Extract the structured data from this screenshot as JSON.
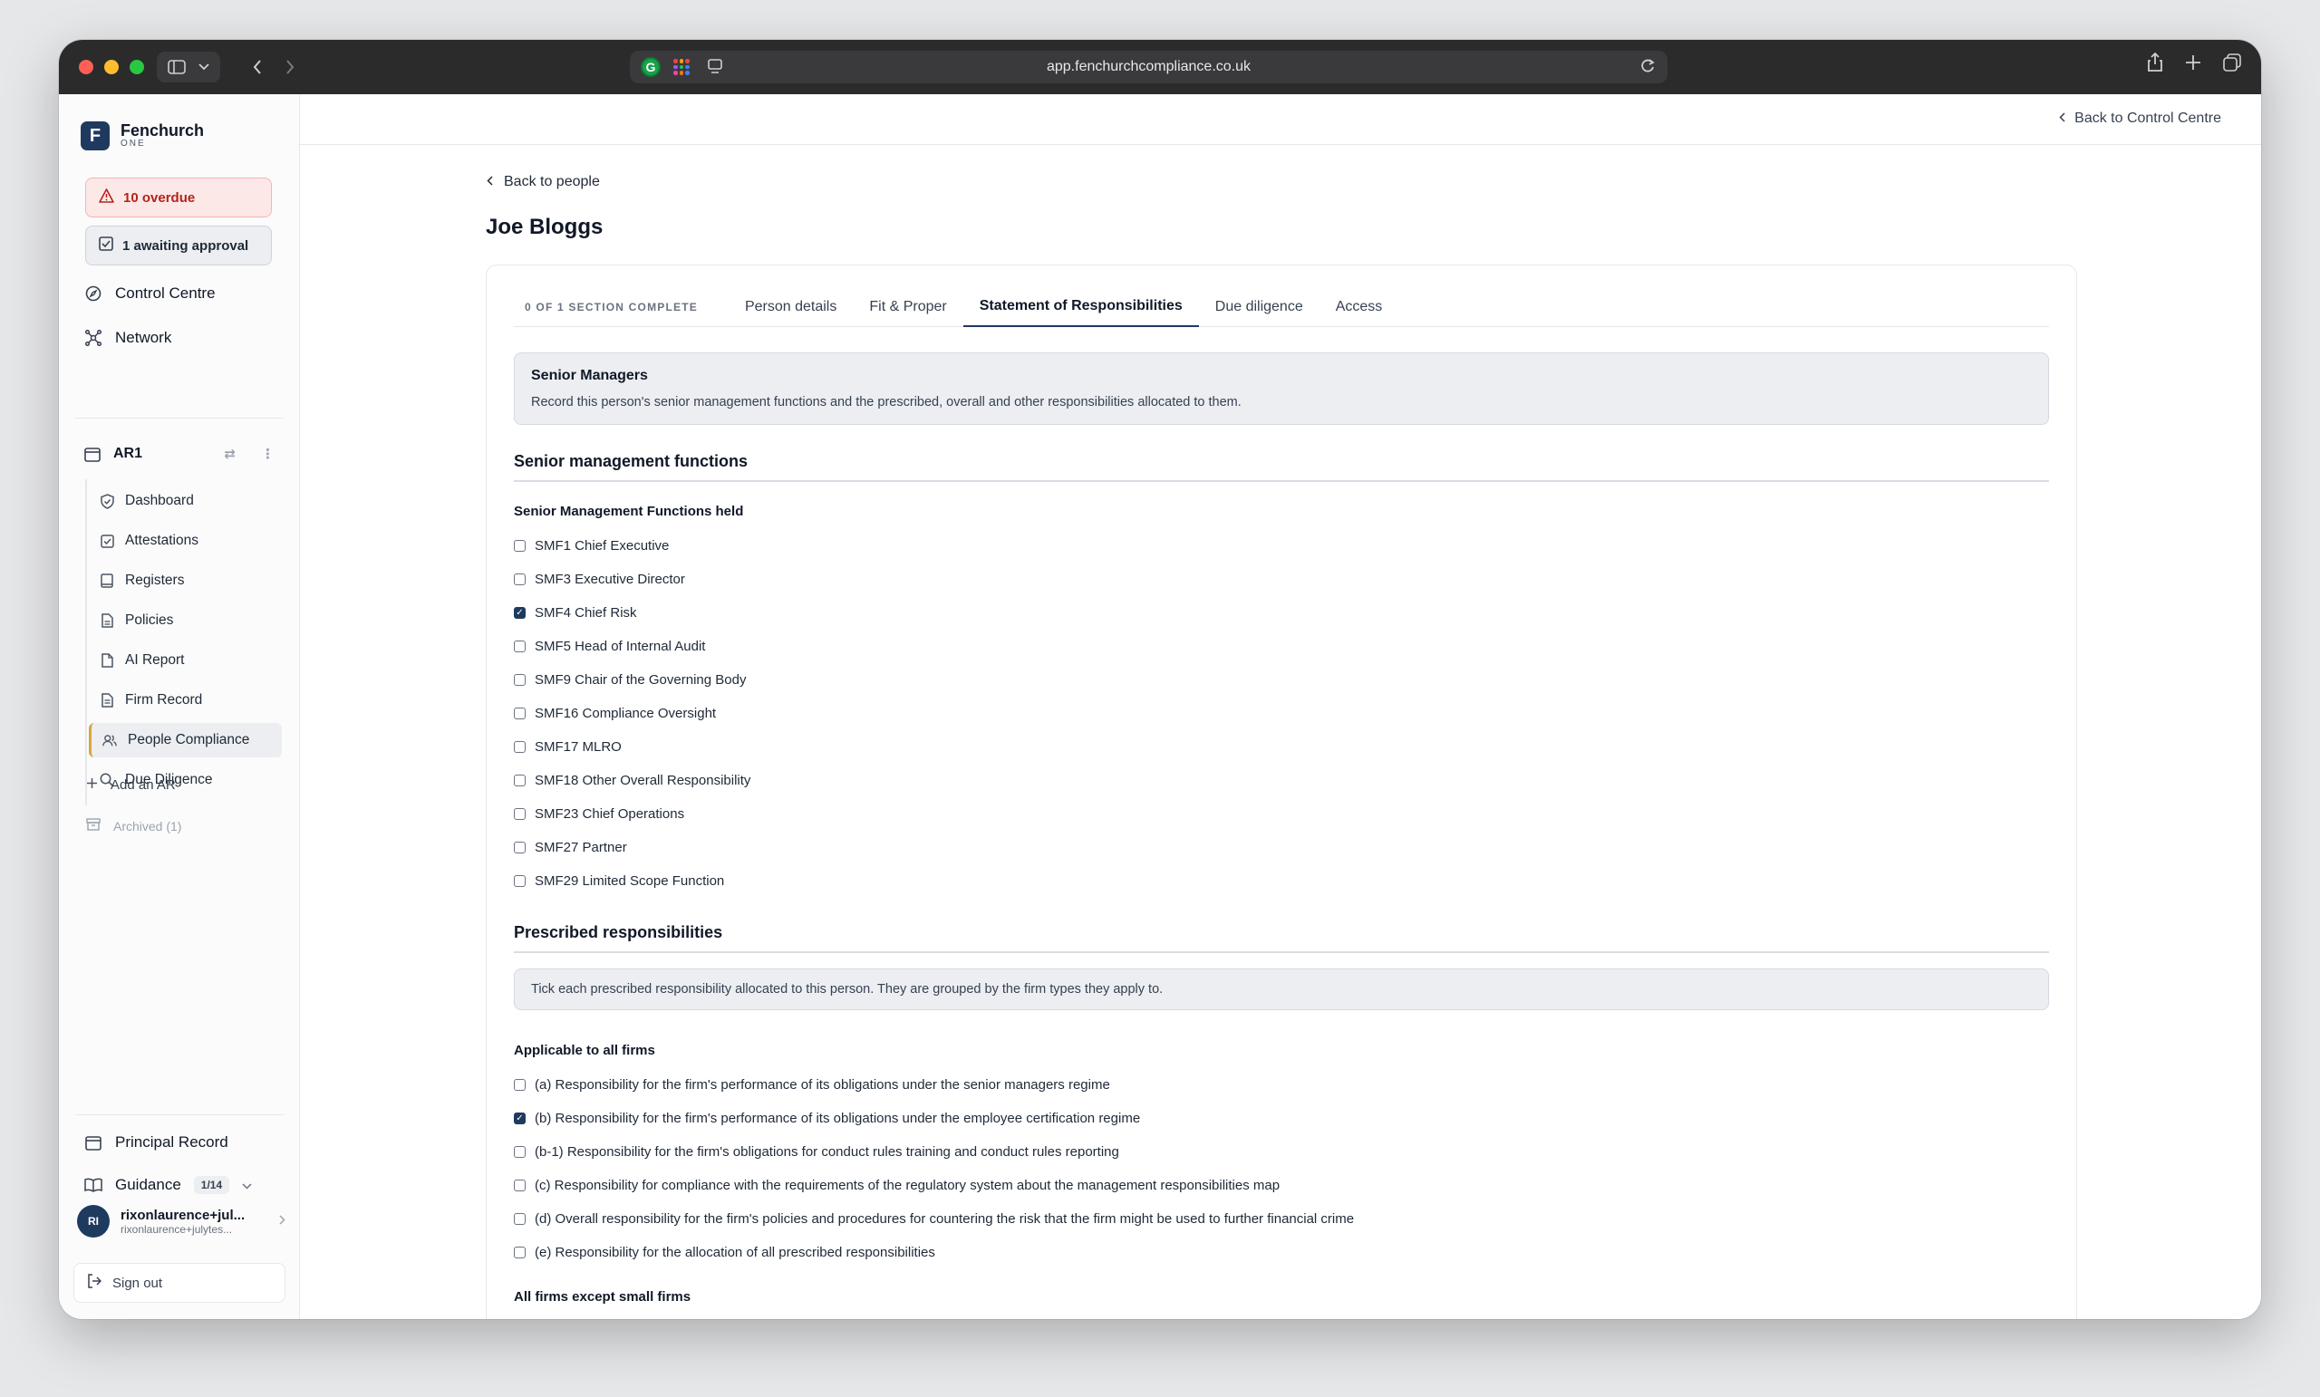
{
  "browser": {
    "url": "app.fenchurchcompliance.co.uk",
    "extension_letter": "G"
  },
  "brand": {
    "name": "Fenchurch",
    "sub": "ONE",
    "logo_letter": "F"
  },
  "alerts": {
    "overdue": "10 overdue",
    "awaiting": "1 awaiting approval"
  },
  "nav": {
    "control_centre": "Control Centre",
    "network": "Network"
  },
  "ar": {
    "name": "AR1",
    "items": [
      {
        "label": "Dashboard",
        "icon": "shield-icon"
      },
      {
        "label": "Attestations",
        "icon": "check-square-icon"
      },
      {
        "label": "Registers",
        "icon": "book-icon"
      },
      {
        "label": "Policies",
        "icon": "document-icon"
      },
      {
        "label": "AI Report",
        "icon": "file-icon"
      },
      {
        "label": "Firm Record",
        "icon": "file-text-icon"
      },
      {
        "label": "People Compliance",
        "icon": "users-icon"
      },
      {
        "label": "Due Diligence",
        "icon": "search-icon"
      }
    ],
    "add": "Add an AR",
    "archived": "Archived (1)"
  },
  "footer_nav": {
    "principal_record": "Principal Record",
    "guidance": "Guidance",
    "guidance_badge": "1/14"
  },
  "user": {
    "initials": "RI",
    "name": "rixonlaurence+jul...",
    "email": "rixonlaurence+julytes..."
  },
  "signout": "Sign out",
  "header": {
    "back_to_cc": "Back to Control Centre"
  },
  "page": {
    "back_to_people": "Back to people",
    "title": "Joe Bloggs"
  },
  "tabs": {
    "progress": "0 OF 1 SECTION COMPLETE",
    "items": [
      "Person details",
      "Fit & Proper",
      "Statement of Responsibilities",
      "Due diligence",
      "Access"
    ],
    "active_index": 2
  },
  "senior_managers": {
    "title": "Senior Managers",
    "text": "Record this person's senior management functions and the prescribed, overall and other responsibilities allocated to them."
  },
  "smf_section": {
    "title": "Senior management functions",
    "group_label": "Senior Management Functions held",
    "options": [
      {
        "label": "SMF1 Chief Executive",
        "checked": false
      },
      {
        "label": "SMF3 Executive Director",
        "checked": false
      },
      {
        "label": "SMF4 Chief Risk",
        "checked": true
      },
      {
        "label": "SMF5 Head of Internal Audit",
        "checked": false
      },
      {
        "label": "SMF9 Chair of the Governing Body",
        "checked": false
      },
      {
        "label": "SMF16 Compliance Oversight",
        "checked": false
      },
      {
        "label": "SMF17 MLRO",
        "checked": false
      },
      {
        "label": "SMF18 Other Overall Responsibility",
        "checked": false
      },
      {
        "label": "SMF23 Chief Operations",
        "checked": false
      },
      {
        "label": "SMF27 Partner",
        "checked": false
      },
      {
        "label": "SMF29 Limited Scope Function",
        "checked": false
      }
    ]
  },
  "prescribed": {
    "title": "Prescribed responsibilities",
    "info": "Tick each prescribed responsibility allocated to this person. They are grouped by the firm types they apply to.",
    "group_all": "Applicable to all firms",
    "options": [
      {
        "label": "(a) Responsibility for the firm's performance of its obligations under the senior managers regime",
        "checked": false
      },
      {
        "label": "(b) Responsibility for the firm's performance of its obligations under the employee certification regime",
        "checked": true
      },
      {
        "label": "(b-1) Responsibility for the firm's obligations for conduct rules training and conduct rules reporting",
        "checked": false
      },
      {
        "label": "(c) Responsibility for compliance with the requirements of the regulatory system about the management responsibilities map",
        "checked": false
      },
      {
        "label": "(d) Overall responsibility for the firm's policies and procedures for countering the risk that the firm might be used to further financial crime",
        "checked": false
      },
      {
        "label": "(e) Responsibility for the allocation of all prescribed responsibilities",
        "checked": false
      }
    ],
    "group_except_small": "All firms except small firms"
  }
}
